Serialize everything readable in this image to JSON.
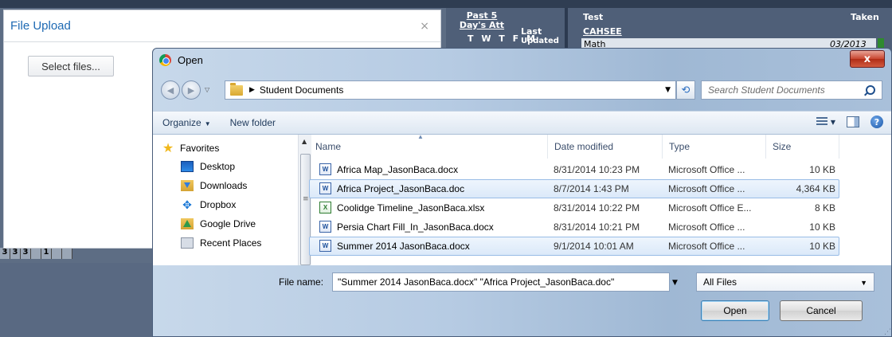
{
  "background": {
    "past_days_att": "Past 5 Day's Att",
    "last_label": "Last",
    "days_label": "T W T F M",
    "updated_label": "Updated",
    "test_label": "Test",
    "taken_label": "Taken",
    "cahsee_label": "CAHSEE",
    "math_label": "Math",
    "math_date": "03/2013",
    "row_numbers": [
      "3",
      "3",
      "3",
      "",
      "1",
      "",
      ""
    ]
  },
  "upload": {
    "title": "File Upload",
    "close_glyph": "×",
    "select_files_label": "Select files..."
  },
  "dialog": {
    "title": "Open",
    "close_glyph": "x",
    "breadcrumb": "Student Documents",
    "search_placeholder": "Search Student Documents",
    "toolbar": {
      "organize_label": "Organize",
      "new_folder_label": "New folder"
    },
    "favorites_label": "Favorites",
    "nav_items": [
      {
        "label": "Desktop",
        "icon": "desktop-icon"
      },
      {
        "label": "Downloads",
        "icon": "downloads-folder-icon"
      },
      {
        "label": "Dropbox",
        "icon": "dropbox-icon"
      },
      {
        "label": "Google Drive",
        "icon": "google-drive-icon"
      },
      {
        "label": "Recent Places",
        "icon": "recent-places-icon"
      }
    ],
    "columns": {
      "name": "Name",
      "date_modified": "Date modified",
      "type": "Type",
      "size": "Size"
    },
    "files": [
      {
        "name": "Africa Map_JasonBaca.docx",
        "date": "8/31/2014 10:23 PM",
        "type": "Microsoft Office ...",
        "size": "10 KB",
        "icon": "W",
        "selected": false
      },
      {
        "name": "Africa Project_JasonBaca.doc",
        "date": "8/7/2014 1:43 PM",
        "type": "Microsoft Office ...",
        "size": "4,364 KB",
        "icon": "W",
        "selected": true
      },
      {
        "name": "Coolidge Timeline_JasonBaca.xlsx",
        "date": "8/31/2014 10:22 PM",
        "type": "Microsoft Office E...",
        "size": "8 KB",
        "icon": "X",
        "selected": false
      },
      {
        "name": "Persia Chart Fill_In_JasonBaca.docx",
        "date": "8/31/2014 10:21 PM",
        "type": "Microsoft Office ...",
        "size": "10 KB",
        "icon": "W",
        "selected": false
      },
      {
        "name": "Summer 2014 JasonBaca.docx",
        "date": "9/1/2014 10:01 AM",
        "type": "Microsoft Office ...",
        "size": "10 KB",
        "icon": "W",
        "selected": true
      }
    ],
    "file_name_label": "File name:",
    "file_name_value": "\"Summer 2014 JasonBaca.docx\" \"Africa Project_JasonBaca.doc\"",
    "filter_value": "All Files",
    "open_label": "Open",
    "cancel_label": "Cancel"
  }
}
